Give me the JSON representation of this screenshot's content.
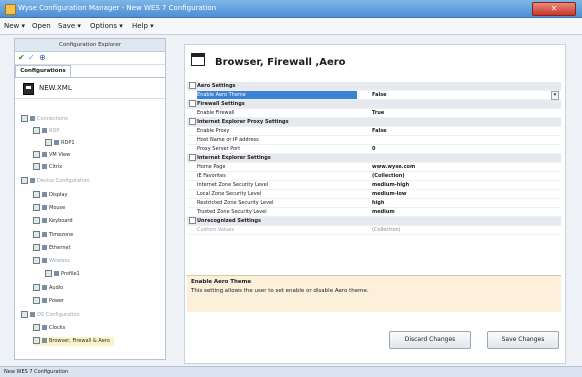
{
  "window": {
    "title": "Wyse Configuration Manager - New WES 7 Configuration",
    "close_label": "✕"
  },
  "menu": [
    "New ▾",
    "Open",
    "Save ▾",
    "Options ▾",
    "Help ▾"
  ],
  "left": {
    "header": "Configuration Explorer",
    "tab": "Configurations",
    "file": "NEW.XML",
    "tree": [
      {
        "label": "Connections",
        "faded": true
      },
      {
        "label": "RDP",
        "faded": true
      },
      {
        "label": "RDP1",
        "faded": false
      },
      {
        "label": "VM View",
        "faded": false
      },
      {
        "label": "Citrix",
        "faded": false
      },
      {
        "label": "Device Configuration",
        "faded": true
      },
      {
        "label": "Display",
        "faded": false
      },
      {
        "label": "Mouse",
        "faded": false
      },
      {
        "label": "Keyboard",
        "faded": false
      },
      {
        "label": "Timezone",
        "faded": false
      },
      {
        "label": "Ethernet",
        "faded": false
      },
      {
        "label": "Wireless",
        "faded": true
      },
      {
        "label": "Profile1",
        "faded": false
      },
      {
        "label": "Audio",
        "faded": false
      },
      {
        "label": "Power",
        "faded": false
      },
      {
        "label": "OS Configuration",
        "faded": true
      },
      {
        "label": "Clocks",
        "faded": false
      },
      {
        "label": "Browser, Firewall & Aero",
        "faded": false
      }
    ]
  },
  "main": {
    "title": "Browser, Firewall ,Aero",
    "sections": [
      {
        "name": "Aero Settings",
        "props": [
          {
            "name": "Enable Aero Theme",
            "value": "False",
            "selected": true,
            "dropdown": true
          }
        ]
      },
      {
        "name": "Firewall Settings",
        "props": [
          {
            "name": "Enable Firewall",
            "value": "True"
          }
        ]
      },
      {
        "name": "Internet Explorer Proxy Settings",
        "props": [
          {
            "name": "Enable Proxy",
            "value": "False"
          },
          {
            "name": "Host Name or IP address",
            "value": ""
          },
          {
            "name": "Proxy Server Port",
            "value": "0"
          }
        ]
      },
      {
        "name": "Internet Explorer Settings",
        "props": [
          {
            "name": "Home Page",
            "value": "www.wyse.com"
          },
          {
            "name": "IE Favorites",
            "value": "(Collection)"
          },
          {
            "name": "Internet Zone Security Level",
            "value": "medium-high"
          },
          {
            "name": "Local Zone Security Level",
            "value": "medium-low"
          },
          {
            "name": "Restricted Zone Security Level",
            "value": "high"
          },
          {
            "name": "Trusted Zone Security Level",
            "value": "medium"
          }
        ]
      },
      {
        "name": "Unrecognized Settings",
        "props": [
          {
            "name": "Custom Values",
            "value": "(Collection)",
            "faded": true
          }
        ]
      }
    ],
    "description": {
      "title": "Enable Aero Theme",
      "text": "This setting allows the user to set enable or disable Aero theme."
    },
    "buttons": {
      "discard": "Discard Changes",
      "save": "Save Changes"
    }
  },
  "status": "New WES 7 Configuration"
}
